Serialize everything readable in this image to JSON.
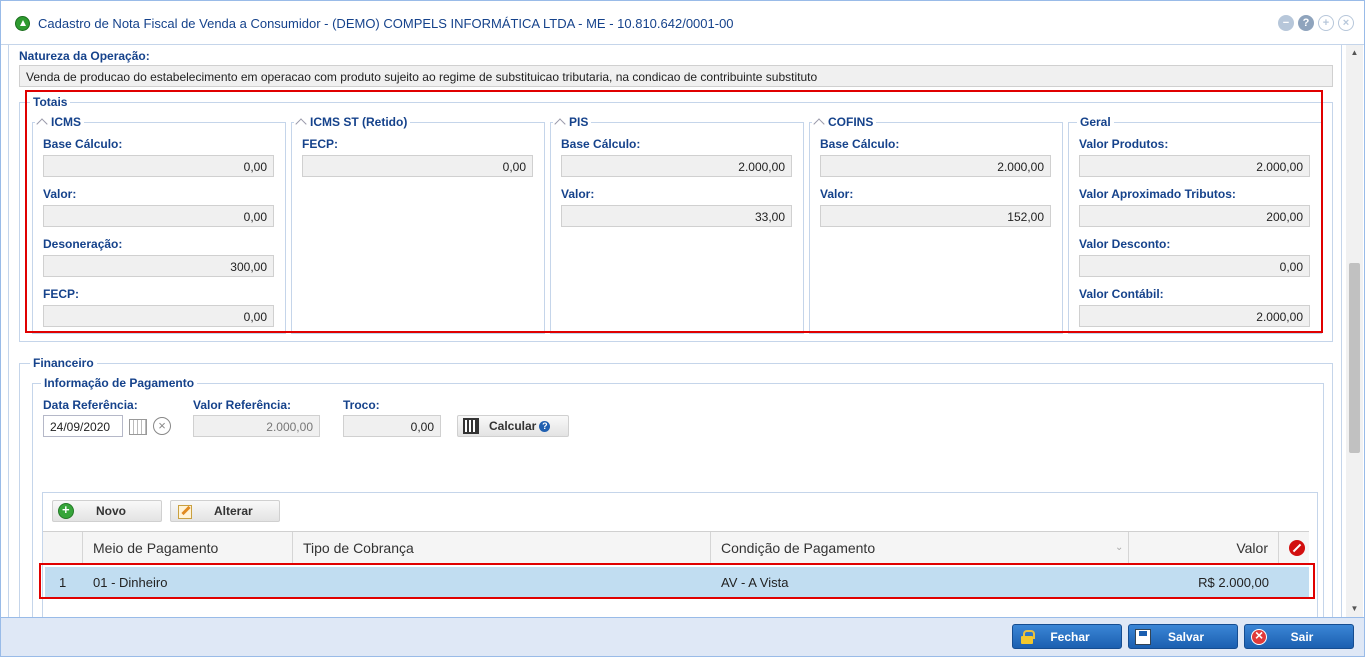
{
  "window": {
    "title": "Cadastro de Nota Fiscal de Venda a Consumidor - (DEMO) COMPELS INFORMÁTICA LTDA - ME - 10.810.642/0001-00"
  },
  "natureza": {
    "label": "Natureza da Operação:",
    "value": "Venda de producao do estabelecimento em operacao com produto sujeito ao regime de substituicao tributaria, na condicao de contribuinte substituto"
  },
  "totais": {
    "legend": "Totais",
    "icms": {
      "legend": "ICMS",
      "base_label": "Base Cálculo:",
      "base_value": "0,00",
      "valor_label": "Valor:",
      "valor_value": "0,00",
      "deson_label": "Desoneração:",
      "deson_value": "300,00",
      "fecp_label": "FECP:",
      "fecp_value": "0,00"
    },
    "icms_st": {
      "legend": "ICMS ST (Retido)",
      "fecp_label": "FECP:",
      "fecp_value": "0,00"
    },
    "pis": {
      "legend": "PIS",
      "base_label": "Base Cálculo:",
      "base_value": "2.000,00",
      "valor_label": "Valor:",
      "valor_value": "33,00"
    },
    "cofins": {
      "legend": "COFINS",
      "base_label": "Base Cálculo:",
      "base_value": "2.000,00",
      "valor_label": "Valor:",
      "valor_value": "152,00"
    },
    "geral": {
      "legend": "Geral",
      "produtos_label": "Valor Produtos:",
      "produtos_value": "2.000,00",
      "tributos_label": "Valor Aproximado Tributos:",
      "tributos_value": "200,00",
      "desconto_label": "Valor Desconto:",
      "desconto_value": "0,00",
      "contabil_label": "Valor Contábil:",
      "contabil_value": "2.000,00"
    }
  },
  "financeiro": {
    "legend": "Financeiro",
    "info_legend": "Informação de Pagamento",
    "data_ref_label": "Data Referência:",
    "data_ref_value": "24/09/2020",
    "valor_ref_label": "Valor Referência:",
    "valor_ref_value": "2.000,00",
    "troco_label": "Troco:",
    "troco_value": "0,00",
    "calcular_label": "Calcular",
    "novo_label": "Novo",
    "alterar_label": "Alterar",
    "columns": [
      "Meio de Pagamento",
      "Tipo de Cobrança",
      "Condição de Pagamento",
      "Valor"
    ],
    "rows": [
      {
        "num": "1",
        "meio": "01 - Dinheiro",
        "tipo": "",
        "condicao": "AV - A Vista",
        "valor": "R$ 2.000,00"
      }
    ]
  },
  "footer": {
    "fechar_label": "Fechar",
    "salvar_label": "Salvar",
    "sair_label": "Sair"
  },
  "colors": {
    "accent": "#15428b",
    "highlight": "#e00000",
    "row_selected": "#c1ddf1"
  }
}
